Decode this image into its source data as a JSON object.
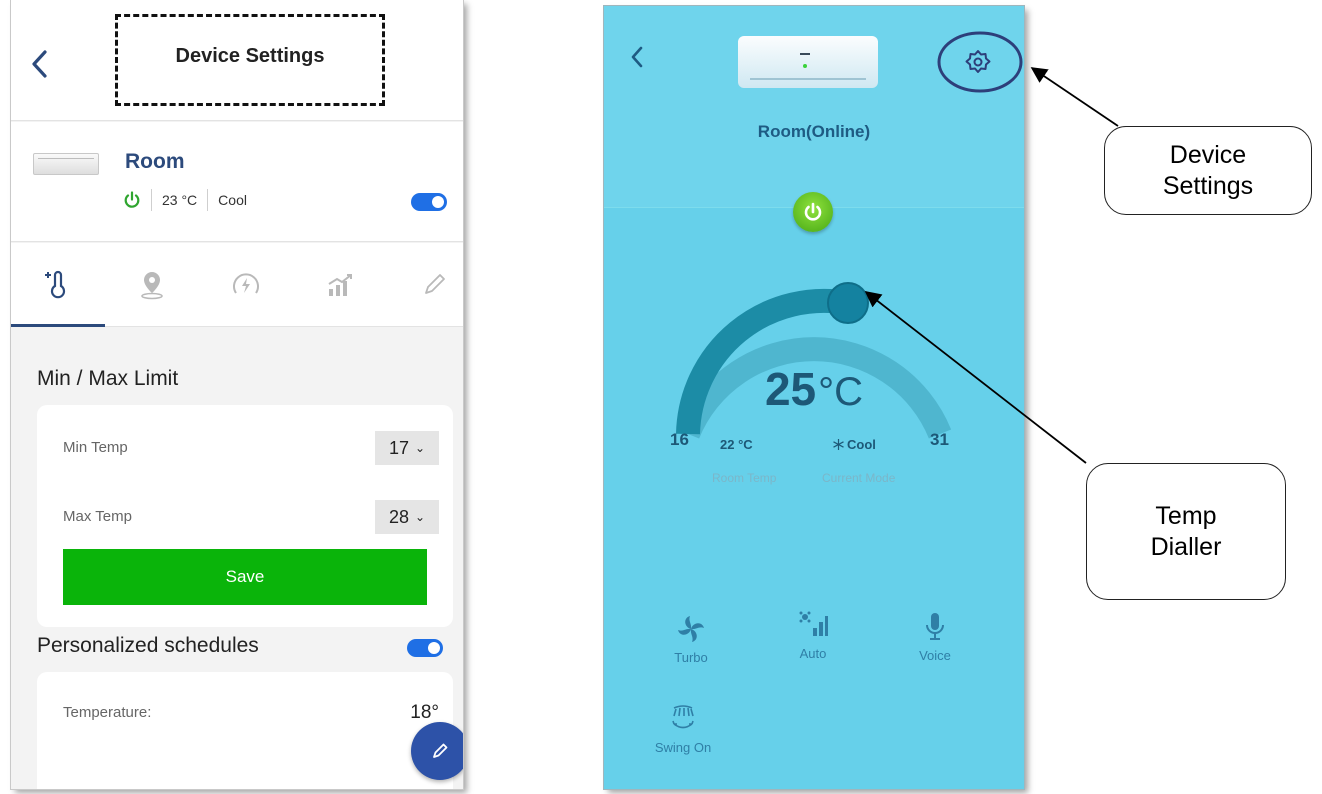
{
  "left_screen": {
    "title": "Device Settings",
    "device": {
      "name": "Room",
      "temperature": "23 °C",
      "mode": "Cool"
    },
    "tabs": [
      "thermometer-plus",
      "location",
      "energy",
      "analytics",
      "edit"
    ],
    "limit_section": {
      "title": "Min / Max Limit",
      "min_label": "Min Temp",
      "min_value": "17",
      "max_label": "Max Temp",
      "max_value": "28",
      "save_label": "Save"
    },
    "schedule_section": {
      "title": "Personalized schedules",
      "temp_label": "Temperature:",
      "temp_value": "18°"
    }
  },
  "right_screen": {
    "device_label": "Room(Online)",
    "set_temp": "25",
    "unit": "°C",
    "min_limit": "16",
    "max_limit": "31",
    "room_temp_value": "22 °C",
    "room_temp_label": "Room Temp",
    "mode_value": "Cool",
    "mode_label": "Current Mode",
    "buttons": {
      "turbo": "Turbo",
      "auto": "Auto",
      "voice": "Voice",
      "swing": "Swing On"
    }
  },
  "annotations": {
    "settings_callout": [
      "Device",
      "Settings"
    ],
    "dial_callout": [
      "Temp",
      "Dialler"
    ]
  },
  "colors": {
    "nav_blue": "#2c4a7c",
    "toggle_blue": "#1f6fe5",
    "save_green": "#0ab40a",
    "screen_cyan": "#66d0ea",
    "dial_dark": "#1c8ca6"
  }
}
